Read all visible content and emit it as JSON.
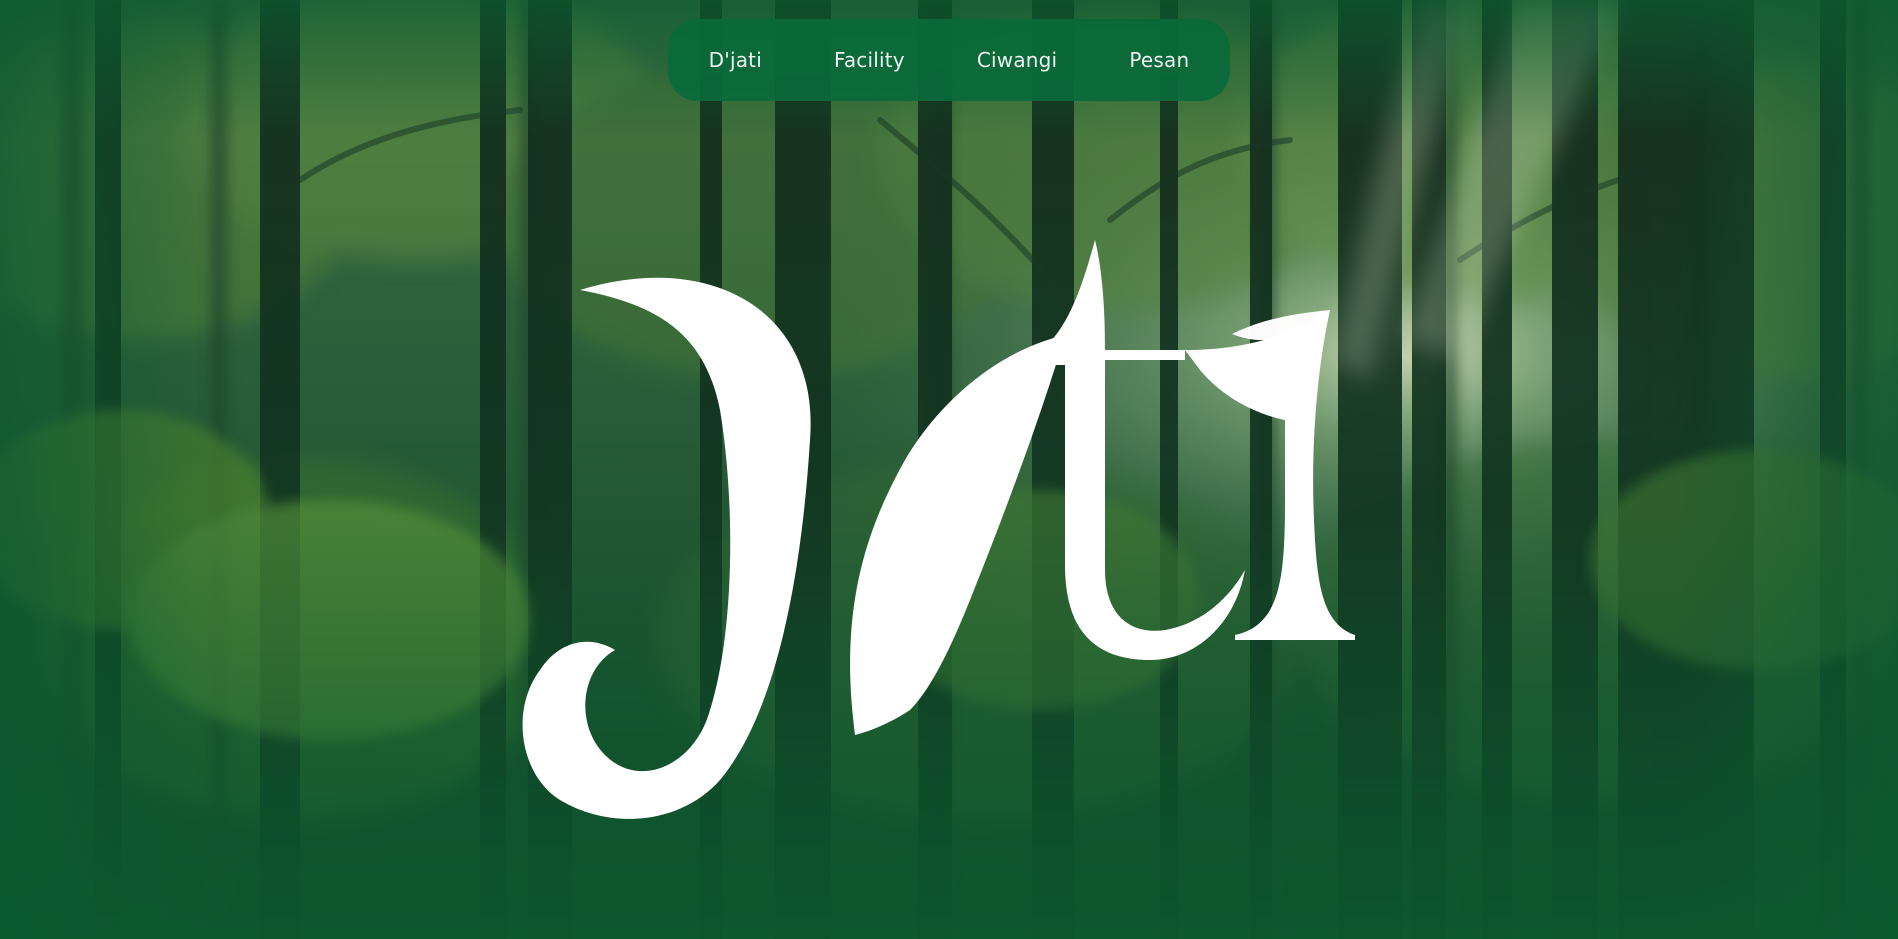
{
  "nav": {
    "items": [
      {
        "label": "D'jati"
      },
      {
        "label": "Facility"
      },
      {
        "label": "Ciwangi"
      },
      {
        "label": "Pesan"
      }
    ]
  },
  "hero": {
    "logo_word": "Jati",
    "background": "forest-photo",
    "colors": {
      "nav_bg": "#0a6a3a",
      "overlay_green": "#0b5a30",
      "logo_fill": "#ffffff"
    }
  }
}
